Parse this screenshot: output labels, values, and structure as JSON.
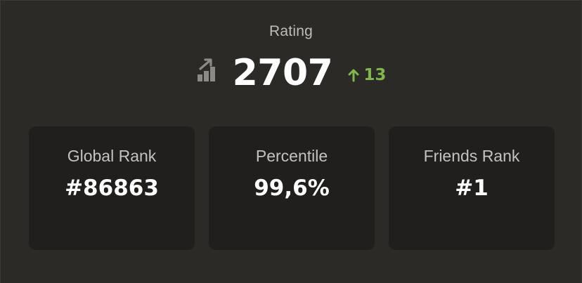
{
  "rating": {
    "label": "Rating",
    "value": "2707",
    "change": "13",
    "icon": "rating-chart-icon",
    "change_icon": "arrow-up-icon",
    "change_color": "#81b64c"
  },
  "stats": [
    {
      "label": "Global Rank",
      "value": "#86863"
    },
    {
      "label": "Percentile",
      "value": "99,6%"
    },
    {
      "label": "Friends Rank",
      "value": "#1"
    }
  ],
  "colors": {
    "background": "#2b2a27",
    "card": "#201f1d",
    "text_primary": "#ffffff",
    "text_secondary": "#c3c2bf",
    "accent_green": "#81b64c"
  }
}
